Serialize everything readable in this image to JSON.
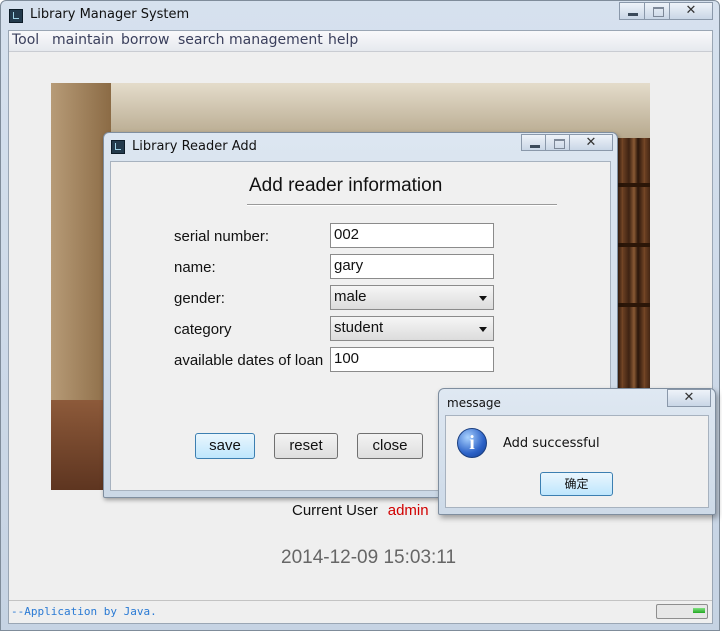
{
  "window": {
    "title": "Library Manager System",
    "close_glyph": "✕"
  },
  "menu": {
    "items": [
      {
        "label": "Tool"
      },
      {
        "label": "maintain"
      },
      {
        "label": "borrow"
      },
      {
        "label": "search"
      },
      {
        "label": "management"
      },
      {
        "label": "help"
      }
    ]
  },
  "background": {
    "description_icon": "library-photo"
  },
  "footer": {
    "current_user_label": "Current User",
    "current_user": "admin",
    "datetime": "2014-12-09 15:03:11",
    "status_text": "--Application by Java.",
    "progress_fraction": 0.25
  },
  "reader_add": {
    "title": "Library Reader Add",
    "heading": "Add reader information",
    "fields": {
      "serial_number": {
        "label": "serial number:",
        "value": "002"
      },
      "name": {
        "label": "name:",
        "value": "gary"
      },
      "gender": {
        "label": "gender:",
        "value": "male"
      },
      "category": {
        "label": "category",
        "value": "student"
      },
      "loan_dates": {
        "label": "available dates of loan",
        "value": "100"
      }
    },
    "buttons": {
      "save": "save",
      "reset": "reset",
      "close": "close"
    }
  },
  "message": {
    "title": "message",
    "text": "Add successful",
    "ok": "确定",
    "icon_glyph": "i"
  },
  "colors": {
    "current_user": "#d10000",
    "status_text": "#2a7ad4",
    "datetime": "#666666"
  }
}
